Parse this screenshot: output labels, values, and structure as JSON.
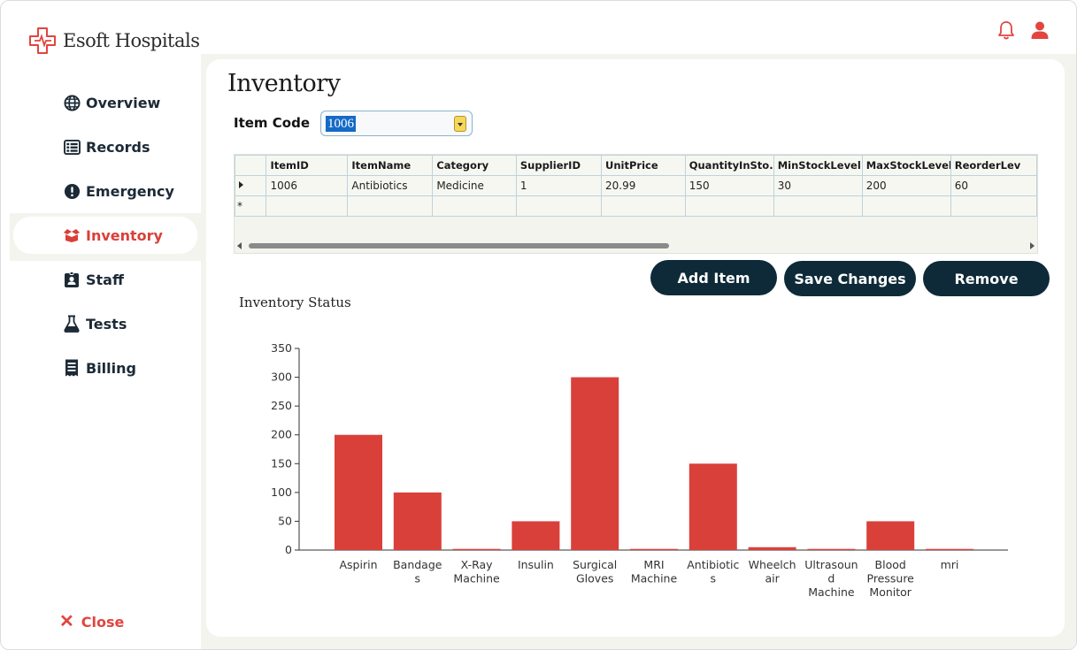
{
  "app": {
    "name": "Esoft Hospitals"
  },
  "sidebar": {
    "items": [
      {
        "label": "Overview",
        "icon": "globe-icon",
        "active": false
      },
      {
        "label": "Records",
        "icon": "list-icon",
        "active": false
      },
      {
        "label": "Emergency",
        "icon": "alert-icon",
        "active": false
      },
      {
        "label": "Inventory",
        "icon": "box-icon",
        "active": true
      },
      {
        "label": "Staff",
        "icon": "id-badge-icon",
        "active": false
      },
      {
        "label": "Tests",
        "icon": "flask-icon",
        "active": false
      },
      {
        "label": "Billing",
        "icon": "receipt-icon",
        "active": false
      }
    ],
    "close_label": "Close"
  },
  "page": {
    "title": "Inventory"
  },
  "item_code": {
    "label": "Item Code",
    "value": "1006"
  },
  "grid": {
    "columns": [
      "ItemID",
      "ItemName",
      "Category",
      "SupplierID",
      "UnitPrice",
      "QuantityInSto...",
      "MinStockLevel",
      "MaxStockLevel",
      "ReorderLev"
    ],
    "rows": [
      [
        "1006",
        "Antibiotics",
        "Medicine",
        "1",
        "20.99",
        "150",
        "30",
        "200",
        "60"
      ]
    ],
    "new_row_marker": "*"
  },
  "buttons": {
    "add": "Add Item",
    "save": "Save Changes",
    "remove": "Remove"
  },
  "colors": {
    "accent": "#d9403a",
    "dark": "#0e2a38",
    "bar": "#d9403a"
  },
  "chart_data": {
    "type": "bar",
    "title": "Inventory Status",
    "categories": [
      [
        "Aspirin"
      ],
      [
        "Bandage",
        "s"
      ],
      [
        "X-Ray",
        "Machine"
      ],
      [
        "Insulin"
      ],
      [
        "Surgical",
        "Gloves"
      ],
      [
        "MRI",
        "Machine"
      ],
      [
        "Antibiotic",
        "s"
      ],
      [
        "Wheelch",
        "air"
      ],
      [
        "Ultrasoun",
        "d",
        "Machine"
      ],
      [
        "Blood",
        "Pressure",
        "Monitor"
      ],
      [
        "mri"
      ]
    ],
    "values": [
      200,
      100,
      2,
      50,
      300,
      2,
      150,
      5,
      2,
      50,
      2
    ],
    "ylim": [
      0,
      350
    ],
    "yticks": [
      0,
      50,
      100,
      150,
      200,
      250,
      300,
      350
    ]
  }
}
